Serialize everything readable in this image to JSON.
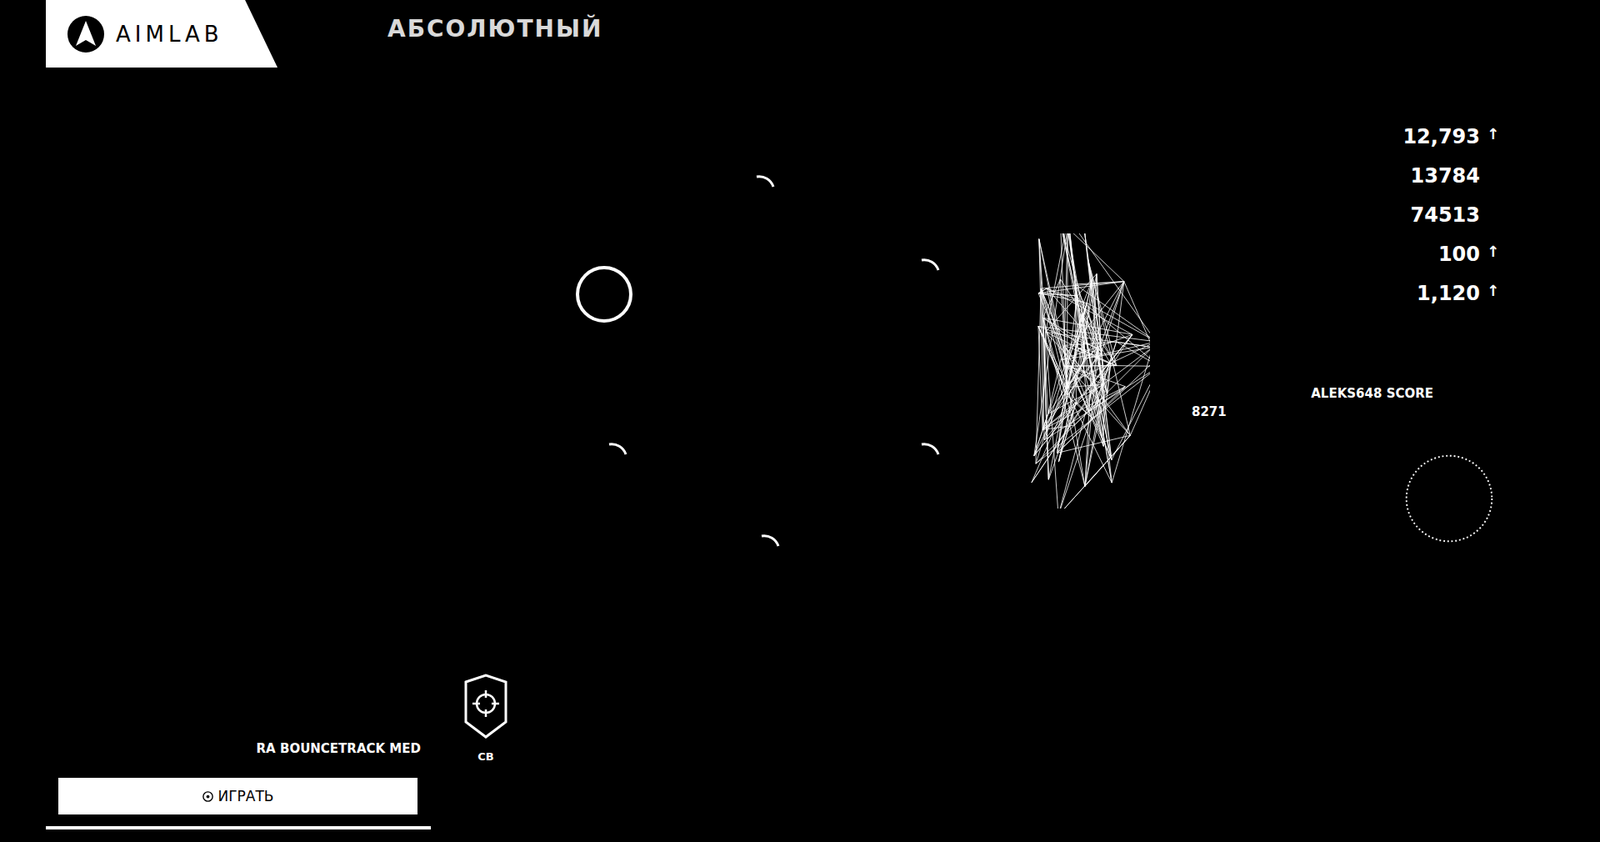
{
  "logo": {
    "text": "AIMLAB"
  },
  "title": "АБСОЛЮТНЫЙ",
  "stats": [
    {
      "value": "12,793",
      "trend": "↑"
    },
    {
      "value": "13784"
    },
    {
      "value": "74513"
    },
    {
      "value": "100",
      "trend": "↑"
    },
    {
      "value": "1,120",
      "trend": "↑"
    }
  ],
  "leaderboard": {
    "label": "ALEKS648 SCORE",
    "score": "8271"
  },
  "task": {
    "name": "RA BOUNCETRACK MED",
    "badge": "CB"
  },
  "play_button": {
    "label": "ИГРАТЬ"
  },
  "targets": [
    {
      "kind": "ring"
    },
    {
      "kind": "arc"
    },
    {
      "kind": "arc"
    },
    {
      "kind": "arc"
    },
    {
      "kind": "arc"
    },
    {
      "kind": "arc"
    }
  ]
}
